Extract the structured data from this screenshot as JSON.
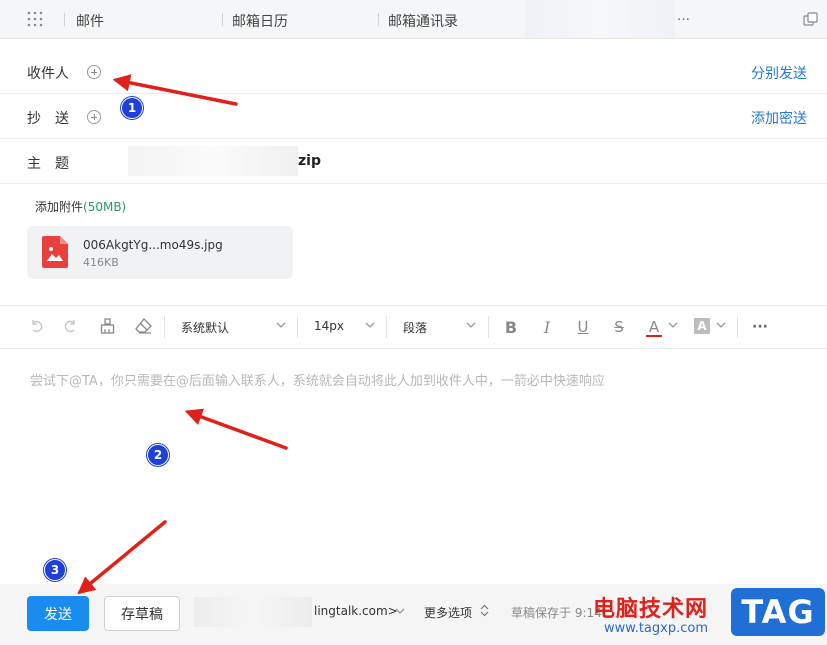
{
  "tabs": [
    {
      "label": "邮件"
    },
    {
      "label": "邮箱日历"
    },
    {
      "label": "邮箱通讯录"
    }
  ],
  "tab_overflow": "…",
  "compose": {
    "to_label": "收件人",
    "cc_label": "抄　送",
    "subject_label": "主　题",
    "subject_visible_suffix": "zip",
    "separate_send": "分别发送",
    "add_bcc": "添加密送"
  },
  "attachments": {
    "label": "添加附件",
    "limit": "(50MB)",
    "items": [
      {
        "name": "006AkgtYg...mo49s.jpg",
        "size": "416KB",
        "icon": "image-file-icon"
      }
    ]
  },
  "toolbar": {
    "font_family": "系统默认",
    "font_size": "14px",
    "paragraph": "段落",
    "bold": "B",
    "italic": "I",
    "underline": "U",
    "strike": "S",
    "font_color": "A",
    "bg_color": "A",
    "more": "···"
  },
  "body": {
    "placeholder": "尝试下@TA，你只需要在@后面输入联系人，系统就会自动将此人加到收件人中，一箭必中快速响应"
  },
  "footer": {
    "send": "发送",
    "save_draft": "存草稿",
    "sender_suffix": "lingtalk.com>",
    "more_options": "更多选项",
    "draft_status": "草稿保存于 9:14:"
  },
  "annotations": {
    "badge1": "1",
    "badge2": "2",
    "badge3": "3"
  },
  "watermark": {
    "text": "电脑技术网",
    "url": "www.tagxp.com",
    "tag": "TAG"
  },
  "colors": {
    "accent": "#1a8cf0",
    "link": "#2878d8",
    "annotation_arrow": "#e0211b",
    "annotation_badge": "#1f3fd8"
  }
}
